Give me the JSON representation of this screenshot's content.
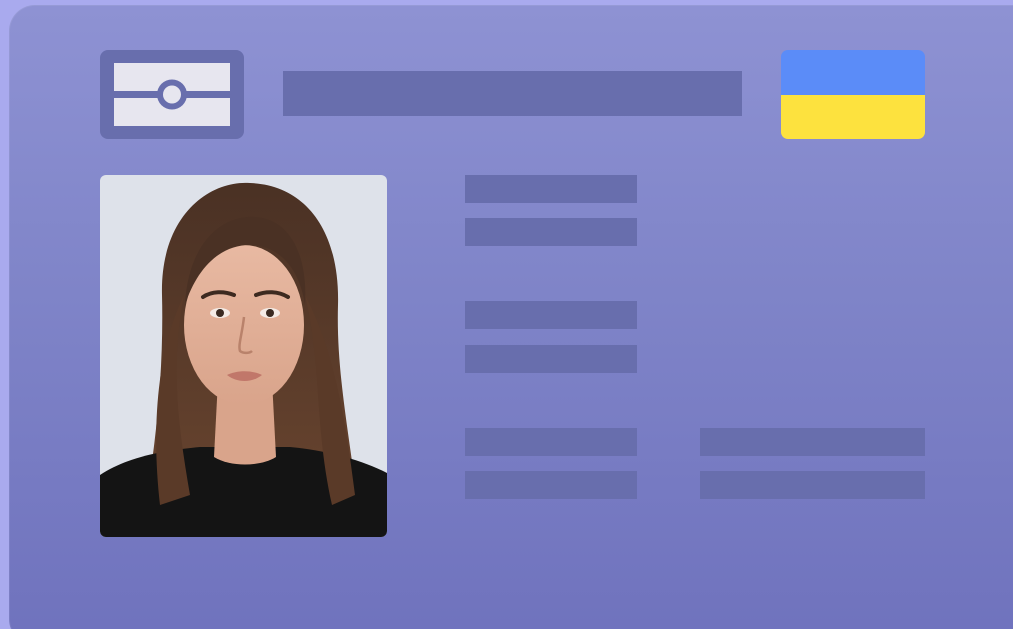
{
  "card": {
    "background_top": "#8e92d3",
    "background_bottom": "#6f72bd",
    "placeholder_color": "#686ead"
  },
  "chip": {
    "icon": "id-chip-icon",
    "frame_color": "#686ead",
    "fill_color": "#e7e6ef"
  },
  "flag": {
    "icon": "ukraine-flag-icon",
    "top_color": "#5b8cf8",
    "bottom_color": "#fde23e"
  },
  "photo": {
    "icon": "portrait-photo",
    "background_color": "#dee2ea"
  }
}
